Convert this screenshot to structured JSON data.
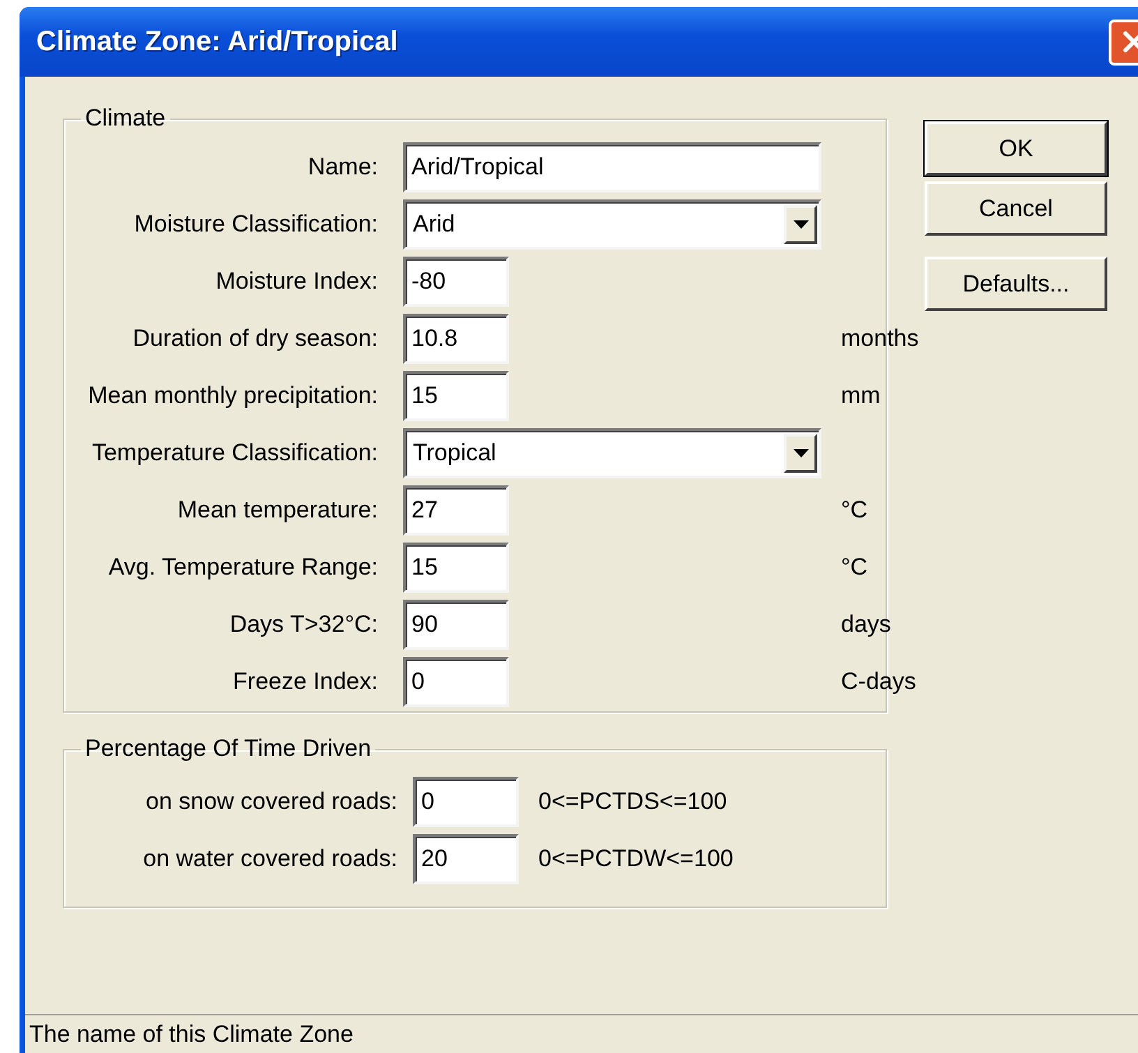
{
  "window": {
    "title": "Climate Zone: Arid/Tropical"
  },
  "climate": {
    "title": "Climate",
    "fields": [
      {
        "kind": "wide-text",
        "label": "Name:",
        "value": "Arid/Tropical"
      },
      {
        "kind": "select",
        "label": "Moisture Classification:",
        "value": "Arid"
      },
      {
        "kind": "text",
        "label": "Moisture Index:",
        "value": "-80"
      },
      {
        "kind": "text",
        "label": "Duration of dry season:",
        "value": "10.8",
        "unit": "months"
      },
      {
        "kind": "text",
        "label": "Mean monthly precipitation:",
        "value": "15",
        "unit": "mm"
      },
      {
        "kind": "select",
        "label": "Temperature Classification:",
        "value": "Tropical"
      },
      {
        "kind": "text",
        "label": "Mean temperature:",
        "value": "27",
        "unit": "°C"
      },
      {
        "kind": "text",
        "label": "Avg. Temperature Range:",
        "value": "15",
        "unit": "°C"
      },
      {
        "kind": "text",
        "label": "Days T>32°C:",
        "value": "90",
        "unit": "days"
      },
      {
        "kind": "text",
        "label": "Freeze Index:",
        "value": "0",
        "unit": "C-days"
      }
    ]
  },
  "driving": {
    "title": "Percentage Of Time Driven",
    "fields": [
      {
        "kind": "text",
        "label": "on snow covered roads:",
        "value": "0",
        "unit": "0<=PCTDS<=100"
      },
      {
        "kind": "text",
        "label": "on water covered roads:",
        "value": "20",
        "unit": "0<=PCTDW<=100"
      }
    ]
  },
  "buttons": [
    {
      "label": "OK",
      "default": true
    },
    {
      "label": "Cancel",
      "default": false
    },
    {
      "label": "Defaults...",
      "default": false
    }
  ],
  "status_bar": {
    "text": "The name of this Climate Zone"
  }
}
